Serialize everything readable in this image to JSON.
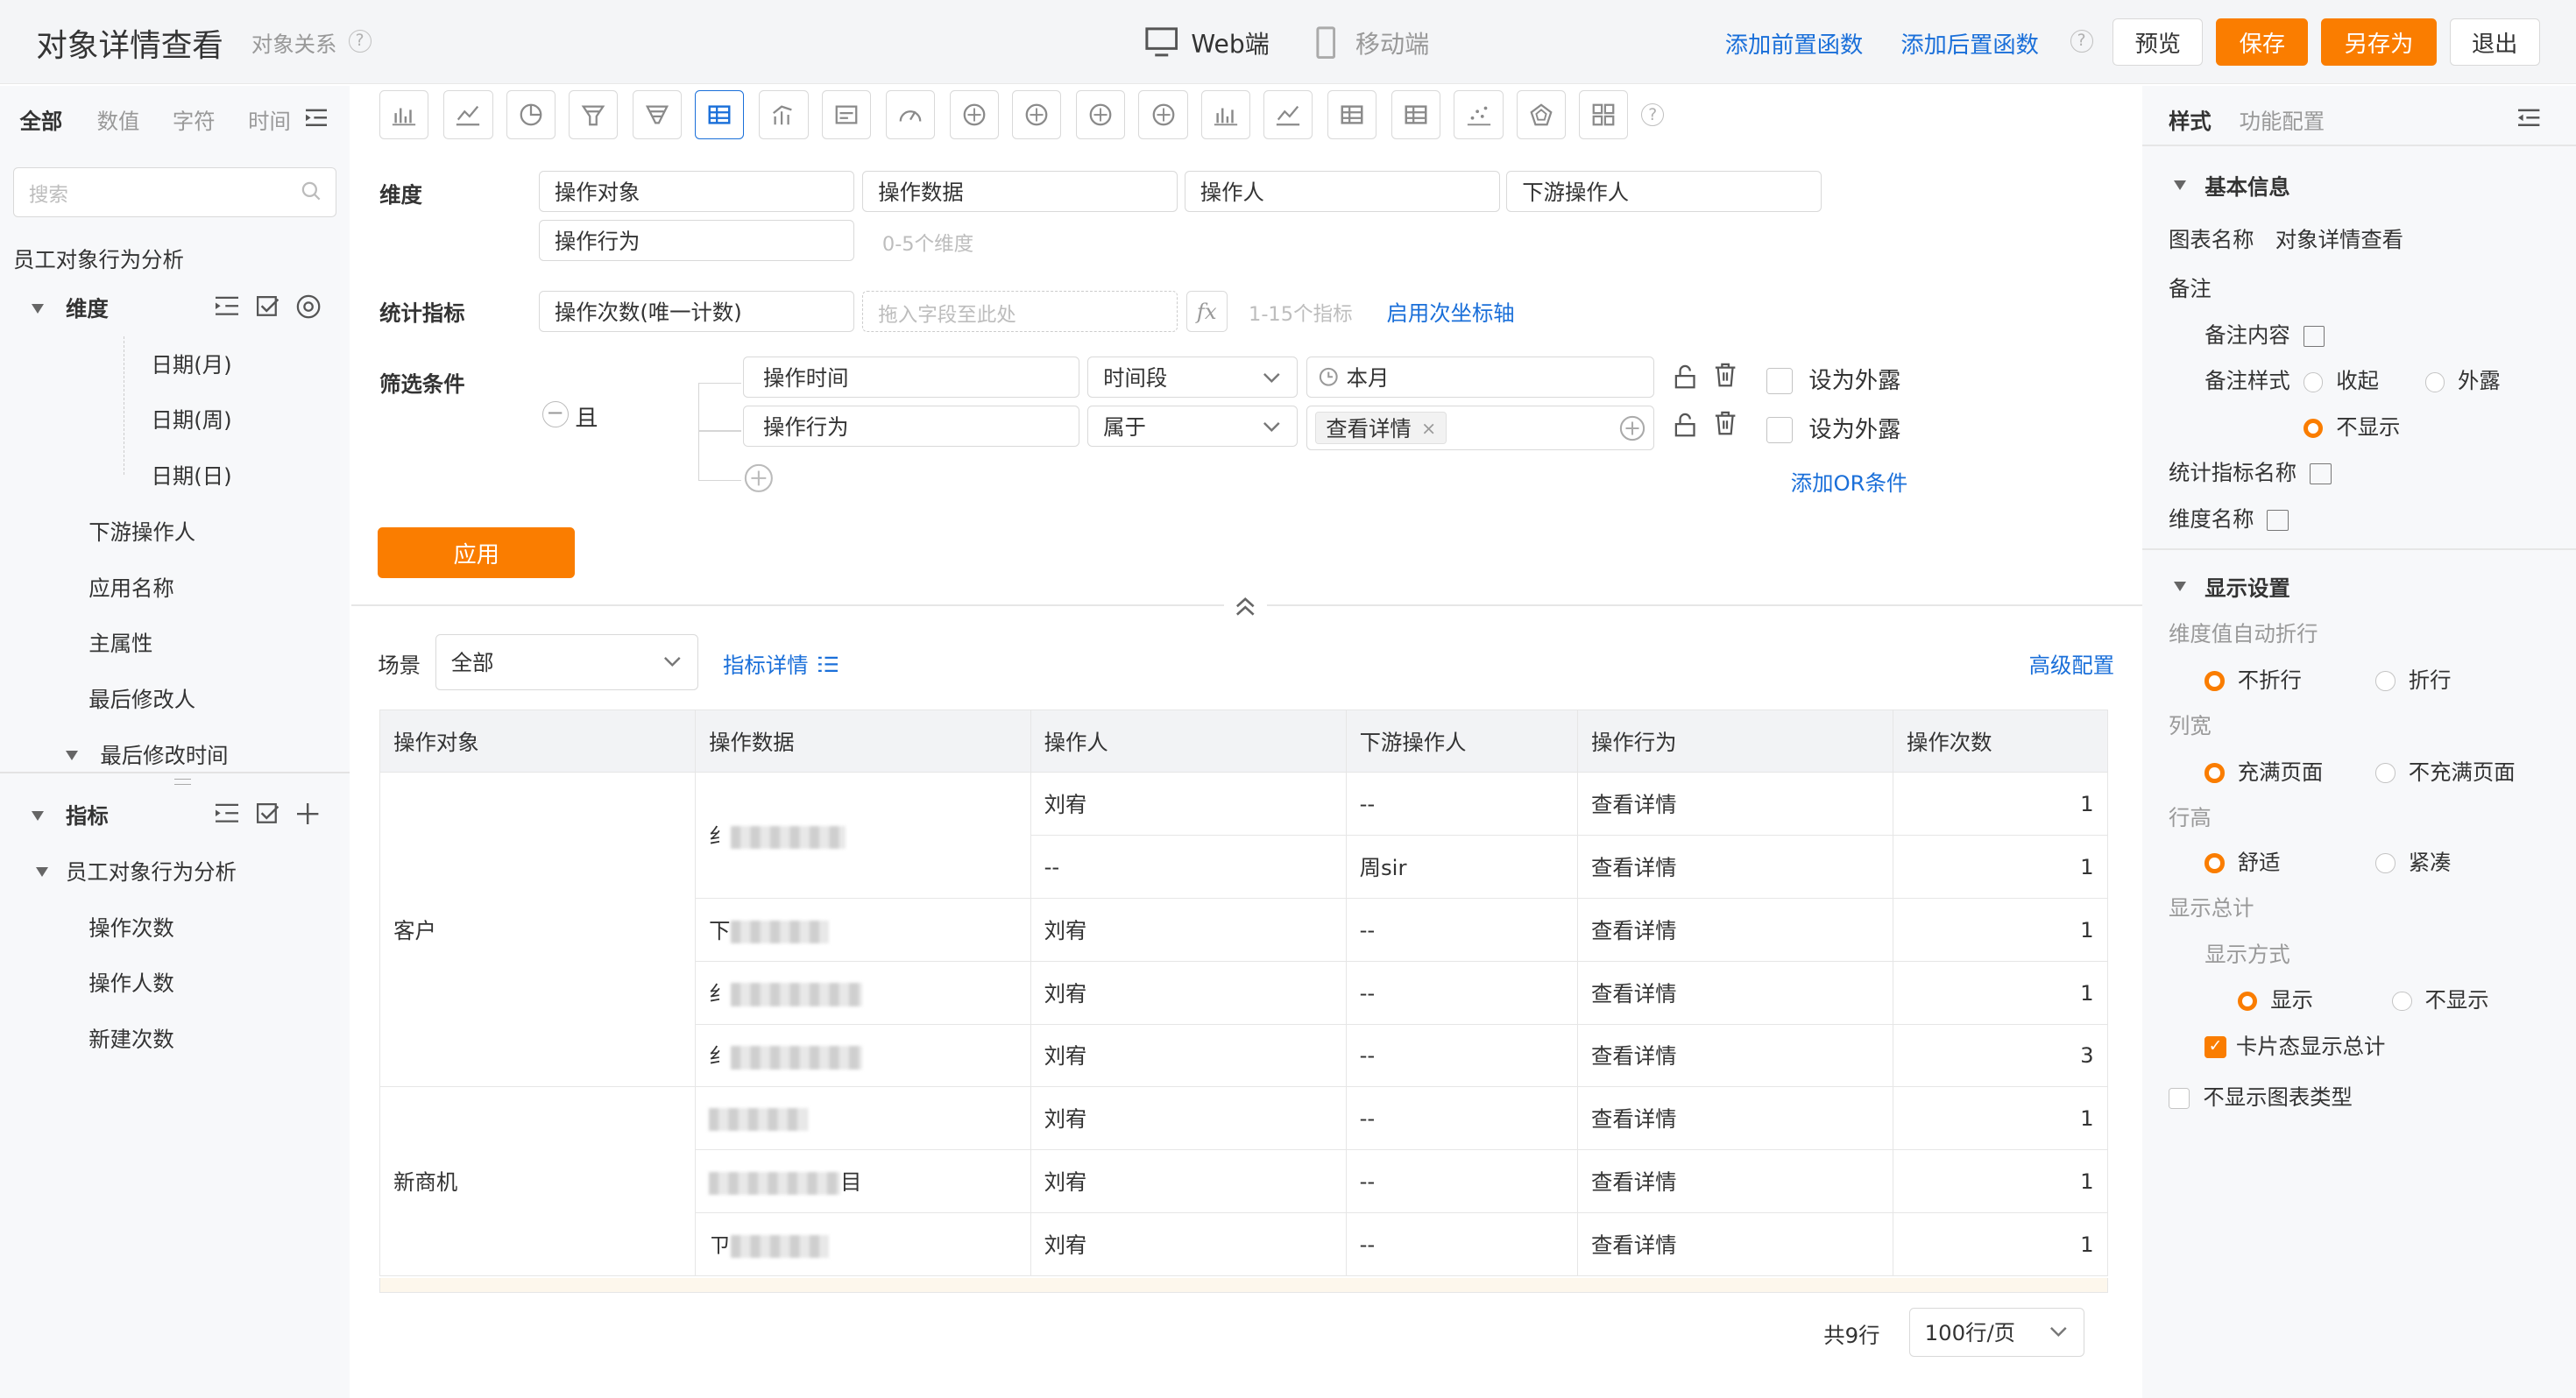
{
  "header": {
    "title": "对象详情查看",
    "relation": "对象关系",
    "tab_web": "Web端",
    "tab_mobile": "移动端",
    "add_pre": "添加前置函数",
    "add_post": "添加后置函数",
    "preview": "预览",
    "save": "保存",
    "save_as": "另存为",
    "exit": "退出"
  },
  "left": {
    "tabs": [
      "全部",
      "数值",
      "字符",
      "时间"
    ],
    "search_placeholder": "搜索",
    "dataset": "员工对象行为分析",
    "dimension_title": "维度",
    "dimension_items": [
      "日期(月)",
      "日期(周)",
      "日期(日)",
      "下游操作人",
      "应用名称",
      "主属性",
      "最后修改人",
      "最后修改时间"
    ],
    "metric_title": "指标",
    "metric_group": "员工对象行为分析",
    "metric_items": [
      "操作次数",
      "操作人数",
      "新建次数"
    ]
  },
  "config": {
    "dimension_label": "维度",
    "dimension_fields": [
      "操作对象",
      "操作数据",
      "操作人",
      "下游操作人",
      "操作行为"
    ],
    "dimension_hint": "0-5个维度",
    "metric_label": "统计指标",
    "metric_field": "操作次数(唯一计数)",
    "metric_drop_placeholder": "拖入字段至此处",
    "metric_hint": "1-15个指标",
    "secondary_axis": "启用次坐标轴",
    "filter_label": "筛选条件",
    "filter_logic": "且",
    "filters": [
      {
        "field": "操作时间",
        "op": "时间段",
        "value": "本月",
        "expose": "设为外露"
      },
      {
        "field": "操作行为",
        "op": "属于",
        "value": "查看详情",
        "expose": "设为外露"
      }
    ],
    "add_or": "添加OR条件",
    "apply": "应用"
  },
  "view": {
    "scene_label": "场景",
    "scene_value": "全部",
    "metric_detail": "指标详情",
    "advanced": "高级配置",
    "columns": [
      "操作对象",
      "操作数据",
      "操作人",
      "下游操作人",
      "操作行为",
      "操作次数"
    ],
    "rows": [
      {
        "obj": "客户",
        "person": "刘宥",
        "down": "--",
        "action": "查看详情",
        "count": "1"
      },
      {
        "person": "--",
        "down": "周sir",
        "action": "查看详情",
        "count": "1"
      },
      {
        "person": "刘宥",
        "down": "--",
        "action": "查看详情",
        "count": "1"
      },
      {
        "person": "刘宥",
        "down": "--",
        "action": "查看详情",
        "count": "1"
      },
      {
        "person": "刘宥",
        "down": "--",
        "action": "查看详情",
        "count": "3"
      },
      {
        "obj": "新商机",
        "person": "刘宥",
        "down": "--",
        "action": "查看详情",
        "count": "1"
      },
      {
        "person": "刘宥",
        "down": "--",
        "action": "查看详情",
        "count": "1"
      },
      {
        "person": "刘宥",
        "down": "--",
        "action": "查看详情",
        "count": "1"
      }
    ],
    "data_prefixes": [
      "纟",
      "",
      "下",
      "纟",
      "纟",
      "",
      "",
      "ㄗ"
    ],
    "data_suffixes": [
      "",
      "",
      "",
      "",
      "",
      "",
      "目",
      ""
    ],
    "total": "共9行",
    "page_size": "100行/页"
  },
  "right": {
    "tab_style": "样式",
    "tab_func": "功能配置",
    "basic_title": "基本信息",
    "chart_name_label": "图表名称",
    "chart_name": "对象详情查看",
    "note_label": "备注",
    "note_content": "备注内容",
    "note_style": "备注样式",
    "note_opts": [
      "收起",
      "外露",
      "不显示"
    ],
    "metric_name": "统计指标名称",
    "dim_name": "维度名称",
    "display_title": "显示设置",
    "wrap_label": "维度值自动折行",
    "wrap_opts": [
      "不折行",
      "折行"
    ],
    "width_label": "列宽",
    "width_opts": [
      "充满页面",
      "不充满页面"
    ],
    "height_label": "行高",
    "height_opts": [
      "舒适",
      "紧凑"
    ],
    "total_label": "显示总计",
    "total_mode": "显示方式",
    "total_opts": [
      "显示",
      "不显示"
    ],
    "card_total": "卡片态显示总计",
    "hide_type": "不显示图表类型"
  }
}
